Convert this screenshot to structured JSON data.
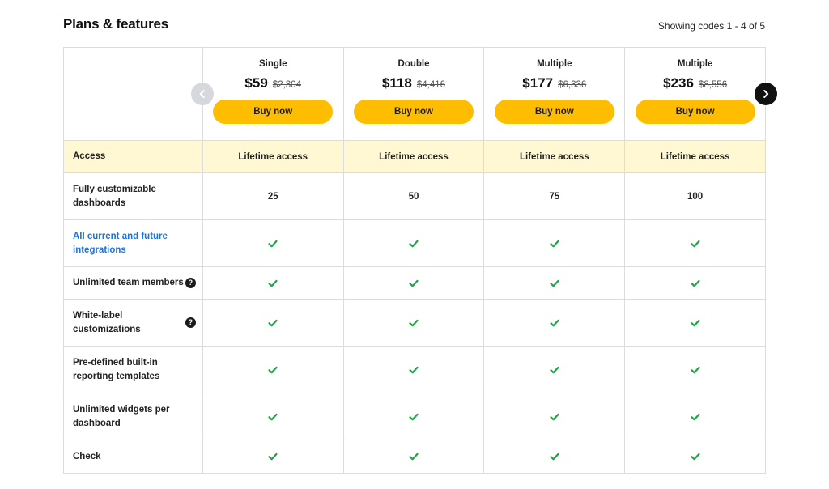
{
  "header": {
    "title": "Plans & features",
    "showing": "Showing codes 1 - 4 of 5"
  },
  "plans": [
    {
      "name": "Single",
      "price": "$59",
      "old_price": "$2,304",
      "buy_label": "Buy now"
    },
    {
      "name": "Double",
      "price": "$118",
      "old_price": "$4,416",
      "buy_label": "Buy now"
    },
    {
      "name": "Multiple",
      "price": "$177",
      "old_price": "$6,336",
      "buy_label": "Buy now"
    },
    {
      "name": "Multiple",
      "price": "$236",
      "old_price": "$8,556",
      "buy_label": "Buy now"
    }
  ],
  "features": {
    "access": {
      "label": "Access",
      "values": [
        "Lifetime access",
        "Lifetime access",
        "Lifetime access",
        "Lifetime access"
      ]
    },
    "dashboards": {
      "label": "Fully customizable dashboards",
      "values": [
        "25",
        "50",
        "75",
        "100"
      ]
    },
    "integrations": {
      "label": "All current and future integrations",
      "values": [
        "check",
        "check",
        "check",
        "check"
      ]
    },
    "team": {
      "label": "Unlimited team members",
      "help_icon": "question-icon",
      "values": [
        "check",
        "check",
        "check",
        "check"
      ]
    },
    "whitelabel": {
      "label": "White-label customizations",
      "help_icon": "question-icon",
      "values": [
        "check",
        "check",
        "check",
        "check"
      ]
    },
    "templates": {
      "label": "Pre-defined built-in reporting templates",
      "values": [
        "check",
        "check",
        "check",
        "check"
      ]
    },
    "widgets": {
      "label": "Unlimited widgets per dashboard",
      "values": [
        "check",
        "check",
        "check",
        "check"
      ]
    },
    "check": {
      "label": "Check",
      "values": [
        "check",
        "check",
        "check",
        "check"
      ]
    }
  },
  "colors": {
    "buy_button": "#ffbd00",
    "access_row_bg": "#fff8d2",
    "check": "#1ea446",
    "link": "#1a73e8"
  },
  "icons": {
    "prev": "chevron-left-icon",
    "next": "chevron-right-icon",
    "help": "question-icon",
    "check": "check-icon"
  }
}
